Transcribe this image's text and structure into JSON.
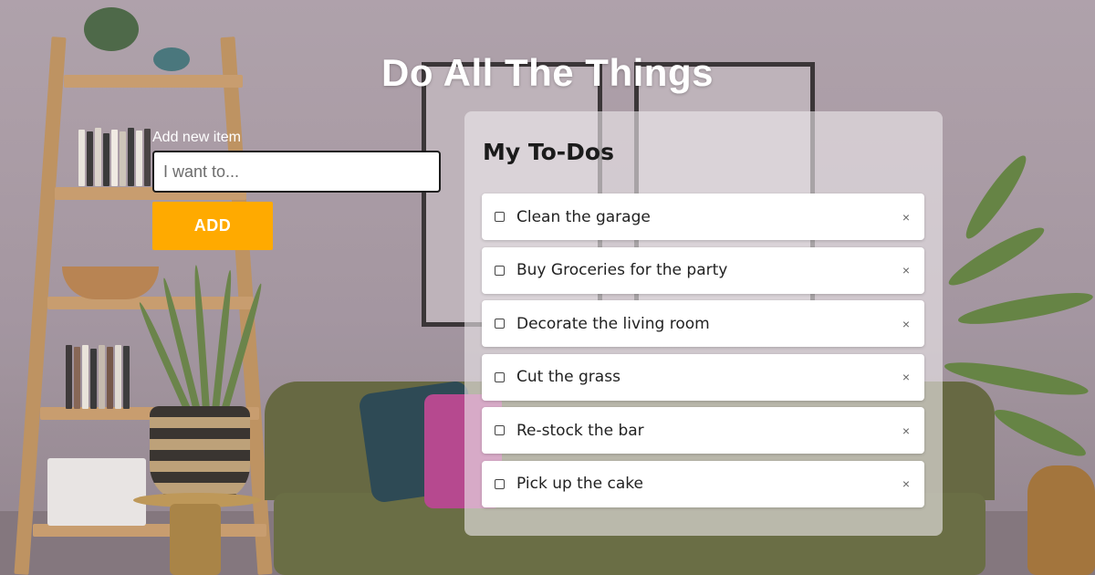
{
  "header": {
    "title": "Do All The Things"
  },
  "form": {
    "label": "Add new item",
    "placeholder": "I want to...",
    "value": "",
    "add_button_label": "ADD",
    "add_button_color": "#ffaa00"
  },
  "todos": {
    "title": "My To-Dos",
    "items": [
      {
        "label": "Clean the garage",
        "done": false
      },
      {
        "label": "Buy Groceries for the party",
        "done": false
      },
      {
        "label": "Decorate the living room",
        "done": false
      },
      {
        "label": "Cut the grass",
        "done": false
      },
      {
        "label": "Re-stock the bar",
        "done": false
      },
      {
        "label": "Pick up the cake",
        "done": false
      }
    ],
    "remove_glyph": "×",
    "remove_icon": "close-icon",
    "checkbox_icon": "checkbox-icon"
  }
}
